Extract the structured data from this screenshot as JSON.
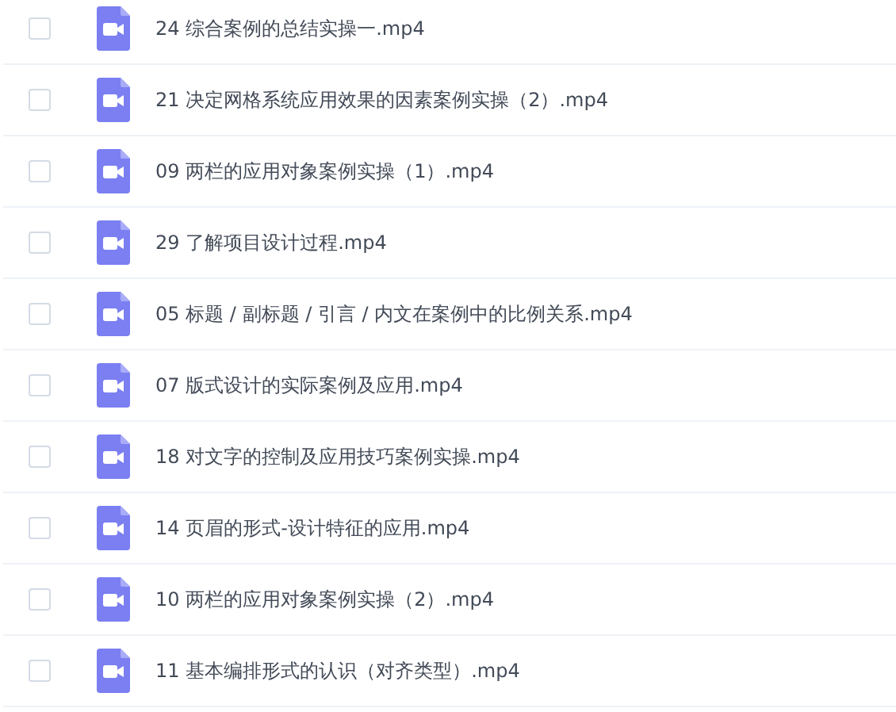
{
  "files": [
    {
      "name": "24 综合案例的总结实操一.mp4",
      "checked": false
    },
    {
      "name": "21 决定网格系统应用效果的因素案例实操（2）.mp4",
      "checked": false
    },
    {
      "name": "09 两栏的应用对象案例实操（1）.mp4",
      "checked": false
    },
    {
      "name": "29 了解项目设计过程.mp4",
      "checked": false
    },
    {
      "name": "05 标题 / 副标题 / 引言 / 内文在案例中的比例关系.mp4",
      "checked": false
    },
    {
      "name": "07 版式设计的实际案例及应用.mp4",
      "checked": false
    },
    {
      "name": "18 对文字的控制及应用技巧案例实操.mp4",
      "checked": false
    },
    {
      "name": "14 页眉的形式-设计特征的应用.mp4",
      "checked": false
    },
    {
      "name": "10 两栏的应用对象案例实操（2）.mp4",
      "checked": false
    },
    {
      "name": "11 基本编排形式的认识（对齐类型）.mp4",
      "checked": false
    }
  ]
}
